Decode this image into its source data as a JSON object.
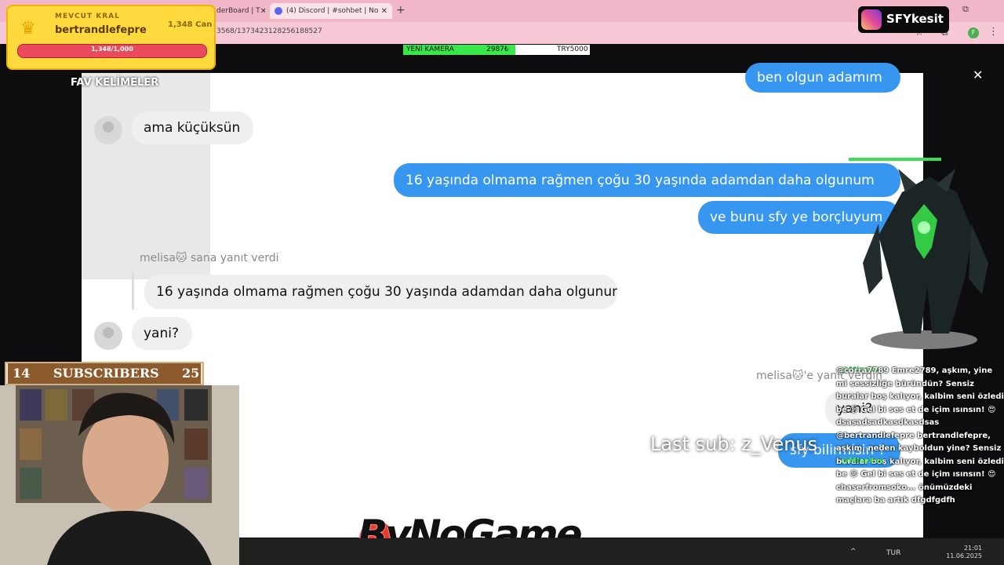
{
  "browser": {
    "tabs": [
      {
        "label": "derBoard | T"
      },
      {
        "label": "(4) Discord | #sohbet | No"
      }
    ],
    "new_tab": "+",
    "url": "3568/1373423128256188527",
    "window_buttons": "– ⧉ ✕"
  },
  "king_panel": {
    "label": "MEVCUT KRAL",
    "name": "bertrandlefepre",
    "hp_value": "1,348 Can",
    "hp_bar_text": "1,348/1,000",
    "hp_fraction": 1.0
  },
  "instagram": {
    "handle": "SFYkesit"
  },
  "camera_bar": {
    "label": "YENİ KAMERA",
    "value": "2987₺",
    "goal": "TRY5000"
  },
  "fav_words_label": "FAV KELİMELER",
  "dm": {
    "messages": [
      {
        "side": "right",
        "text": "ben olgun adamım"
      },
      {
        "side": "left",
        "text": "ama küçüksün"
      },
      {
        "side": "right",
        "text": "16 yaşında olmama rağmen çoğu 30 yaşında adamdan daha olgunum"
      },
      {
        "side": "right",
        "text": "ve bunu sfy ye borçluyum"
      },
      {
        "side": "left",
        "text": "16 yaşında olmama rağmen çoğu 30 yaşında adamdan daha olgunum"
      },
      {
        "side": "left",
        "text": "yani?"
      },
      {
        "side": "right",
        "text": "yani?"
      },
      {
        "side": "right",
        "text": "sfy bilirmisin ?"
      }
    ],
    "reply_info_1": "melisa🐱 sana yanıt verdi",
    "reply_info_2": "melisa🐱'e yanıt verdin"
  },
  "last_sub": "Last sub: z_Venus",
  "sponsor": "ByNoGame",
  "subscribers": {
    "left": "14",
    "label": "SUBSCRIBERS",
    "right": "25"
  },
  "chat_feed": {
    "mention_1": "@MissXss",
    "mention_2": "@MissXss",
    "text": "@corra7789 Emre2789, aşkım, yine mi sessizliğe büründün? Sensiz buralar boş kalıyor, kalbim seni özledi be 😢 Gel bi ses et de içim ısınsın! 😍 dsasadsadkasdkasdsas @bertrandlefepre bertrandlefepre, aşkım, neden kayboldun yine? Sensiz buralar boş kalıyor, kalbim seni özledi be 😢 Gel bi ses et de içim ısınsın! 😍 chaserfromsoko... önümüzdeki maçlara ba artık dfgdfgdfh"
  },
  "taskbar": {
    "lang": "TUR",
    "time": "21:01",
    "date": "11.06.2025",
    "tray": "^"
  },
  "colors": {
    "accent_blue": "#3797f0",
    "king_gold": "#ffd93d",
    "hp_red": "#e94b5c",
    "cam_green": "#38e84a"
  }
}
